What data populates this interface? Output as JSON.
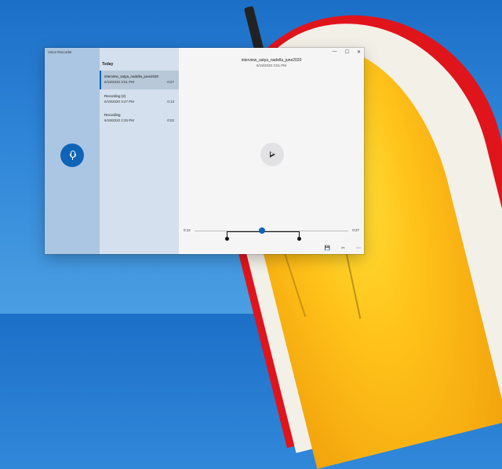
{
  "window": {
    "app_title": "Voice Recorder",
    "controls": {
      "minimize": "—",
      "maximize": "☐",
      "close": "✕"
    }
  },
  "record_button": {
    "icon": "microphone-icon"
  },
  "list": {
    "section_header": "Today",
    "items": [
      {
        "name": "interview_satya_nadella_june2020",
        "date": "6/19/2020 3:51 PM",
        "duration": "0:27",
        "selected": true
      },
      {
        "name": "Recording (2)",
        "date": "6/19/2020 3:47 PM",
        "duration": "0:13",
        "selected": false
      },
      {
        "name": "Recording",
        "date": "6/19/2020 2:26 PM",
        "duration": "0:02",
        "selected": false
      }
    ]
  },
  "player": {
    "title": "interview_satya_nadella_june2020",
    "date": "6/19/2020 3:51 PM",
    "position": "0:12",
    "length": "0:27",
    "progress": 0.44
  },
  "toolbar": {
    "save": "💾",
    "trim": "✂",
    "more": "⋯"
  },
  "colors": {
    "accent": "#0f64b8",
    "left_pane": "#96b9dc",
    "list_pane": "#cddceb"
  }
}
